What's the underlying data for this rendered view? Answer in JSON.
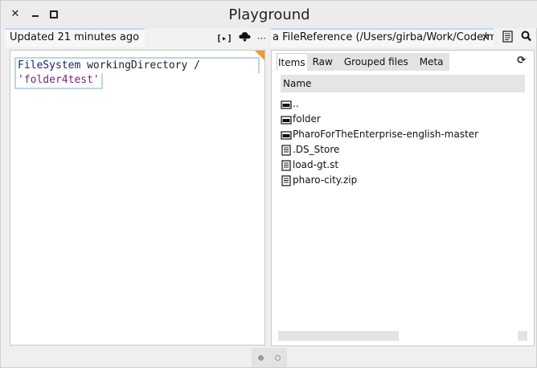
{
  "window": {
    "title": "Playground",
    "close_label": "✕",
    "min_label": "",
    "max_label": ""
  },
  "left": {
    "tab_label": "Updated 21 minutes ago",
    "play_label": "[▸]",
    "more_label": "⋯",
    "code_line1_class": "FileSystem",
    "code_line1_rest": " workingDirectory /",
    "code_line2": "'folder4test'"
  },
  "right": {
    "tab_label": "a FileReference (/Users/girba/Work/Code/moos",
    "close_label": "✕",
    "subtabs": [
      "Items",
      "Raw",
      "Grouped files",
      "Meta"
    ],
    "column_header": "Name",
    "rows": [
      {
        "name": "..",
        "icon": "folder-icon"
      },
      {
        "name": "folder",
        "icon": "folder-icon"
      },
      {
        "name": "PharoForTheEnterprise-english-master",
        "icon": "folder-icon"
      },
      {
        "name": ".DS_Store",
        "icon": "file-icon"
      },
      {
        "name": "load-gt.st",
        "icon": "file-icon"
      },
      {
        "name": "pharo-city.zip",
        "icon": "file-icon"
      }
    ]
  },
  "colors": {
    "accent_tab": "#c3d9f0",
    "corner": "#f19a2a",
    "class_token": "#1a237e",
    "string_token": "#7b1f7e"
  }
}
